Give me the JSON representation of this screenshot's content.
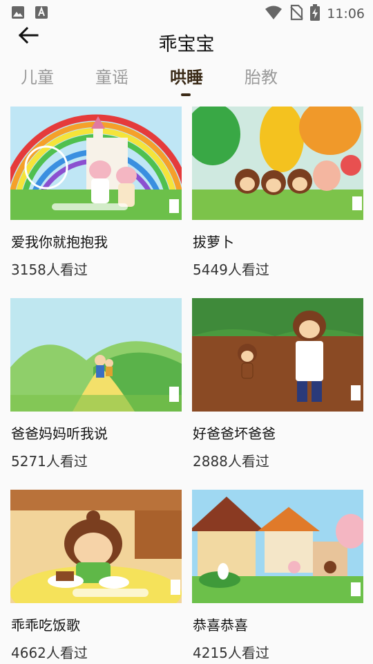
{
  "status_bar": {
    "time": "11:06",
    "left_icons": [
      "image-icon",
      "font-icon"
    ],
    "right_icons": [
      "wifi-icon",
      "no-sim-icon",
      "battery-charging-icon"
    ]
  },
  "header": {
    "title": "乖宝宝",
    "back_icon": "back-arrow-icon"
  },
  "tabs": [
    {
      "label": "儿童",
      "active": false
    },
    {
      "label": "童谣",
      "active": false
    },
    {
      "label": "哄睡",
      "active": true
    },
    {
      "label": "胎教",
      "active": false
    }
  ],
  "videos": [
    {
      "title": "爱我你就抱抱我",
      "views": "3158人看过"
    },
    {
      "title": "拔萝卜",
      "views": "5449人看过"
    },
    {
      "title": "爸爸妈妈听我说",
      "views": "5271人看过"
    },
    {
      "title": "好爸爸坏爸爸",
      "views": "2888人看过"
    },
    {
      "title": "乖乖吃饭歌",
      "views": "4662人看过"
    },
    {
      "title": "恭喜恭喜",
      "views": "4215人看过"
    }
  ],
  "colors": {
    "background": "#fafafa",
    "active_tab": "#3a2a17",
    "inactive_tab": "#9a9a9a"
  }
}
